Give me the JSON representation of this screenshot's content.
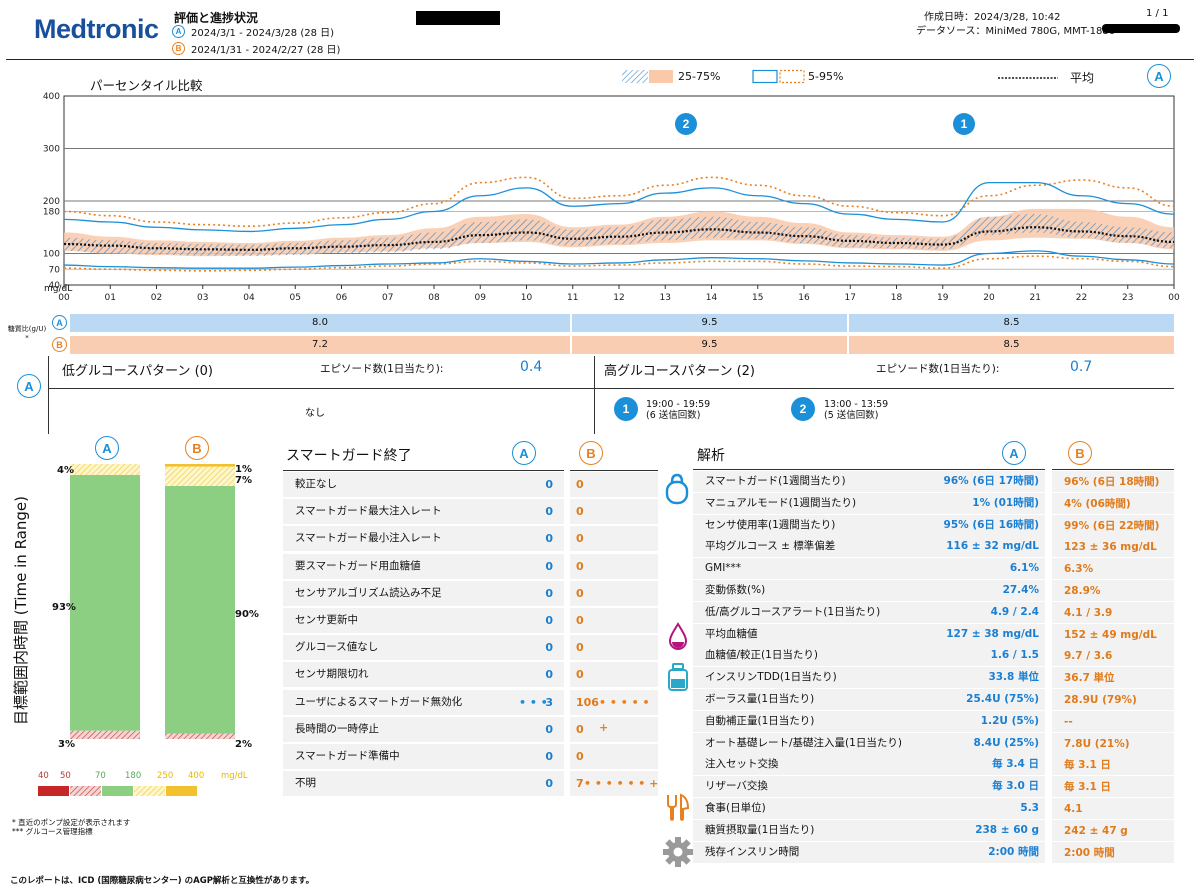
{
  "header": {
    "brand": "Medtronic",
    "report_title": "評価と進捗状況",
    "period_a_label": "A",
    "period_a": "2024/3/1 - 2024/3/28 (28 日)",
    "period_b_label": "B",
    "period_b": "2024/1/31 - 2024/2/27 (28 日)",
    "created": "作成日時：2024/3/28, 10:42",
    "page": "1 / 1",
    "data_source": "データソース：MiniMed 780G, MMT-1886"
  },
  "agp": {
    "title": "パーセンタイル比較",
    "legend_iqr": "25-75%",
    "legend_range": "5-95%",
    "legend_mean": "平均",
    "period_marker": "A",
    "unit": "mg/dL",
    "marker_2": "2",
    "marker_1": "1",
    "colors": {
      "a": "#1b8fd8",
      "b": "#e8801f",
      "b_fill": "#f9c9aa",
      "a_fill": "#5a9bd0"
    }
  },
  "chart_data": {
    "type": "area",
    "ylabel": "mg/dL",
    "ylim": [
      40,
      400
    ],
    "yticks": [
      40,
      70,
      100,
      180,
      200,
      300,
      400
    ],
    "x_hours": [
      "00",
      "01",
      "02",
      "03",
      "04",
      "05",
      "06",
      "07",
      "08",
      "09",
      "10",
      "11",
      "12",
      "13",
      "14",
      "15",
      "16",
      "17",
      "18",
      "19",
      "20",
      "21",
      "22",
      "23",
      "00"
    ],
    "x": [
      0,
      1,
      2,
      3,
      4,
      5,
      6,
      7,
      8,
      9,
      10,
      11,
      12,
      13,
      14,
      15,
      16,
      17,
      18,
      19,
      20,
      21,
      22,
      23,
      24
    ],
    "series": [
      {
        "name": "A 25-75%",
        "p25": [
          105,
          100,
          98,
          96,
          95,
          97,
          100,
          102,
          108,
          120,
          125,
          115,
          118,
          125,
          130,
          128,
          120,
          112,
          110,
          108,
          135,
          140,
          130,
          120,
          110
        ],
        "p75": [
          130,
          125,
          120,
          118,
          117,
          120,
          125,
          130,
          140,
          160,
          165,
          145,
          150,
          165,
          170,
          160,
          150,
          135,
          130,
          128,
          170,
          175,
          160,
          150,
          140
        ]
      },
      {
        "name": "B 25-75%",
        "p25": [
          105,
          100,
          97,
          95,
          96,
          98,
          102,
          104,
          110,
          120,
          122,
          112,
          116,
          120,
          125,
          125,
          118,
          110,
          108,
          105,
          125,
          130,
          128,
          120,
          108
        ],
        "p75": [
          140,
          132,
          125,
          122,
          120,
          124,
          130,
          135,
          148,
          170,
          175,
          150,
          155,
          170,
          180,
          170,
          158,
          140,
          135,
          132,
          170,
          185,
          185,
          170,
          150
        ]
      },
      {
        "name": "A 5-95%",
        "p5": [
          78,
          75,
          73,
          72,
          72,
          74,
          77,
          80,
          82,
          90,
          85,
          80,
          82,
          88,
          92,
          90,
          86,
          82,
          80,
          78,
          100,
          105,
          95,
          88,
          80
        ],
        "p95": [
          165,
          160,
          150,
          145,
          142,
          148,
          155,
          165,
          180,
          210,
          225,
          190,
          195,
          215,
          225,
          210,
          195,
          175,
          165,
          160,
          235,
          235,
          210,
          195,
          175
        ]
      },
      {
        "name": "B 5-95%",
        "p5": [
          72,
          70,
          68,
          67,
          68,
          70,
          73,
          76,
          80,
          85,
          82,
          76,
          78,
          82,
          85,
          85,
          80,
          76,
          75,
          72,
          90,
          95,
          90,
          85,
          75
        ],
        "p95": [
          180,
          172,
          160,
          155,
          152,
          158,
          168,
          178,
          195,
          235,
          245,
          205,
          210,
          230,
          245,
          230,
          210,
          190,
          178,
          172,
          210,
          230,
          240,
          225,
          190
        ]
      },
      {
        "name": "平均",
        "values": [
          118,
          115,
          110,
          108,
          107,
          110,
          113,
          116,
          122,
          135,
          140,
          128,
          132,
          140,
          146,
          140,
          133,
          124,
          120,
          117,
          142,
          150,
          142,
          133,
          122
        ]
      }
    ]
  },
  "carb_ratio": {
    "label": "糖質比(g/U) *",
    "a_label": "A",
    "b_label": "B",
    "a_values": [
      "8.0",
      "9.5",
      "8.5"
    ],
    "b_values": [
      "7.2",
      "9.5",
      "8.5"
    ]
  },
  "patterns": {
    "period_label": "A",
    "low_title": "低グルコースパターン (0)",
    "low_episodes_label": "エピソード数(1日当たり):",
    "low_episodes": "0.4",
    "low_none": "なし",
    "high_title": "高グルコースパターン (2)",
    "high_episodes_label": "エピソード数(1日当たり):",
    "high_episodes": "0.7",
    "high_items": [
      {
        "num": "1",
        "time": "19:00 - 19:59",
        "note": "(6 送信回数)"
      },
      {
        "num": "2",
        "time": "13:00 - 13:59",
        "note": "(5 送信回数)"
      }
    ]
  },
  "tir": {
    "axis_label": "目標範囲内時間 (Time in Range)",
    "a_label": "A",
    "b_label": "B",
    "a_high": "4%",
    "a_in": "93%",
    "a_low": "3%",
    "b_vhigh": "1%",
    "b_high": "7%",
    "b_in": "90%",
    "b_low": "2%",
    "a_fraction": {
      "high": 0.04,
      "in": 0.93,
      "low": 0.03
    },
    "b_fraction": {
      "vhigh": 0.01,
      "high": 0.07,
      "in": 0.9,
      "low": 0.02
    },
    "legend": {
      "t40": "40",
      "t50": "50",
      "t70": "70",
      "t180": "180",
      "t250": "250",
      "t400": "400",
      "unit": "mg/dL"
    }
  },
  "footnotes": {
    "note1": "* 直近のポンプ設定が表示されます",
    "note2": "*** グルコース管理指標",
    "bottom": "このレポートは、ICD (国際糖尿病センター) のAGP解析と互換性があります。"
  },
  "smartguard": {
    "title": "スマートガード終了",
    "a_label": "A",
    "b_label": "B",
    "rows": [
      {
        "label": "較正なし",
        "a": "0",
        "b": "0"
      },
      {
        "label": "スマートガード最大注入レート",
        "a": "0",
        "b": "0"
      },
      {
        "label": "スマートガード最小注入レート",
        "a": "0",
        "b": "0"
      },
      {
        "label": "要スマートガード用血糖値",
        "a": "0",
        "b": "0"
      },
      {
        "label": "センサアルゴリズム読込み不足",
        "a": "0",
        "b": "0"
      },
      {
        "label": "センサ更新中",
        "a": "0",
        "b": "0"
      },
      {
        "label": "グルコース値なし",
        "a": "0",
        "b": "0"
      },
      {
        "label": "センサ期限切れ",
        "a": "0",
        "b": "0"
      },
      {
        "label": "ユーザによるスマートガード無効化",
        "a": "3",
        "b": "106"
      },
      {
        "label": "長時間の一時停止",
        "a": "0",
        "b": "0"
      },
      {
        "label": "スマートガード準備中",
        "a": "0",
        "b": "0"
      },
      {
        "label": "不明",
        "a": "0",
        "b": "7"
      }
    ]
  },
  "analysis": {
    "title": "解析",
    "a_label": "A",
    "b_label": "B",
    "rows": [
      {
        "label": "スマートガード(1週間当たり)",
        "a": "96% (6日 17時間)",
        "b": "96% (6日 18時間)"
      },
      {
        "label": "マニュアルモード(1週間当たり)",
        "a": "1% (01時間)",
        "b": "4% (06時間)"
      },
      {
        "label": "センサ使用率(1週間当たり)",
        "a": "95% (6日 16時間)",
        "b": "99% (6日 22時間)"
      },
      {
        "label": "平均グルコース ± 標準偏差",
        "a": "116 ± 32 mg/dL",
        "b": "123 ± 36 mg/dL"
      },
      {
        "label": "GMI***",
        "a": "6.1%",
        "b": "6.3%"
      },
      {
        "label": "変動係数(%)",
        "a": "27.4%",
        "b": "28.9%"
      },
      {
        "label": "低/高グルコースアラート(1日当たり)",
        "a": "4.9 / 2.4",
        "b": "4.1 / 3.9"
      },
      {
        "label": "平均血糖値",
        "a": "127 ± 38 mg/dL",
        "b": "152 ± 49 mg/dL"
      },
      {
        "label": "血糖値/較正(1日当たり)",
        "a": "1.6 / 1.5",
        "b": "9.7 / 3.6"
      },
      {
        "label": "インスリンTDD(1日当たり)",
        "a": "33.8 単位",
        "b": "36.7 単位"
      },
      {
        "label": "ボーラス量(1日当たり)",
        "a": "25.4U (75%)",
        "b": "28.9U (79%)"
      },
      {
        "label": "自動補正量(1日当たり)",
        "a": "1.2U (5%)",
        "b": "--"
      },
      {
        "label": "オート基礎レート/基礎注入量(1日当たり)",
        "a": "8.4U (25%)",
        "b": "7.8U (21%)"
      },
      {
        "label": "注入セット交換",
        "a": "毎 3.4 日",
        "b": "毎 3.1 日"
      },
      {
        "label": "リザーバ交換",
        "a": "毎 3.0 日",
        "b": "毎 3.1 日"
      },
      {
        "label": "食事(日単位)",
        "a": "5.3",
        "b": "4.1"
      },
      {
        "label": "糖質摂取量(1日当たり)",
        "a": "238 ± 60 g",
        "b": "242 ± 47 g"
      },
      {
        "label": "残存インスリン時間",
        "a": "2:00 時間",
        "b": "2:00 時間"
      }
    ]
  }
}
